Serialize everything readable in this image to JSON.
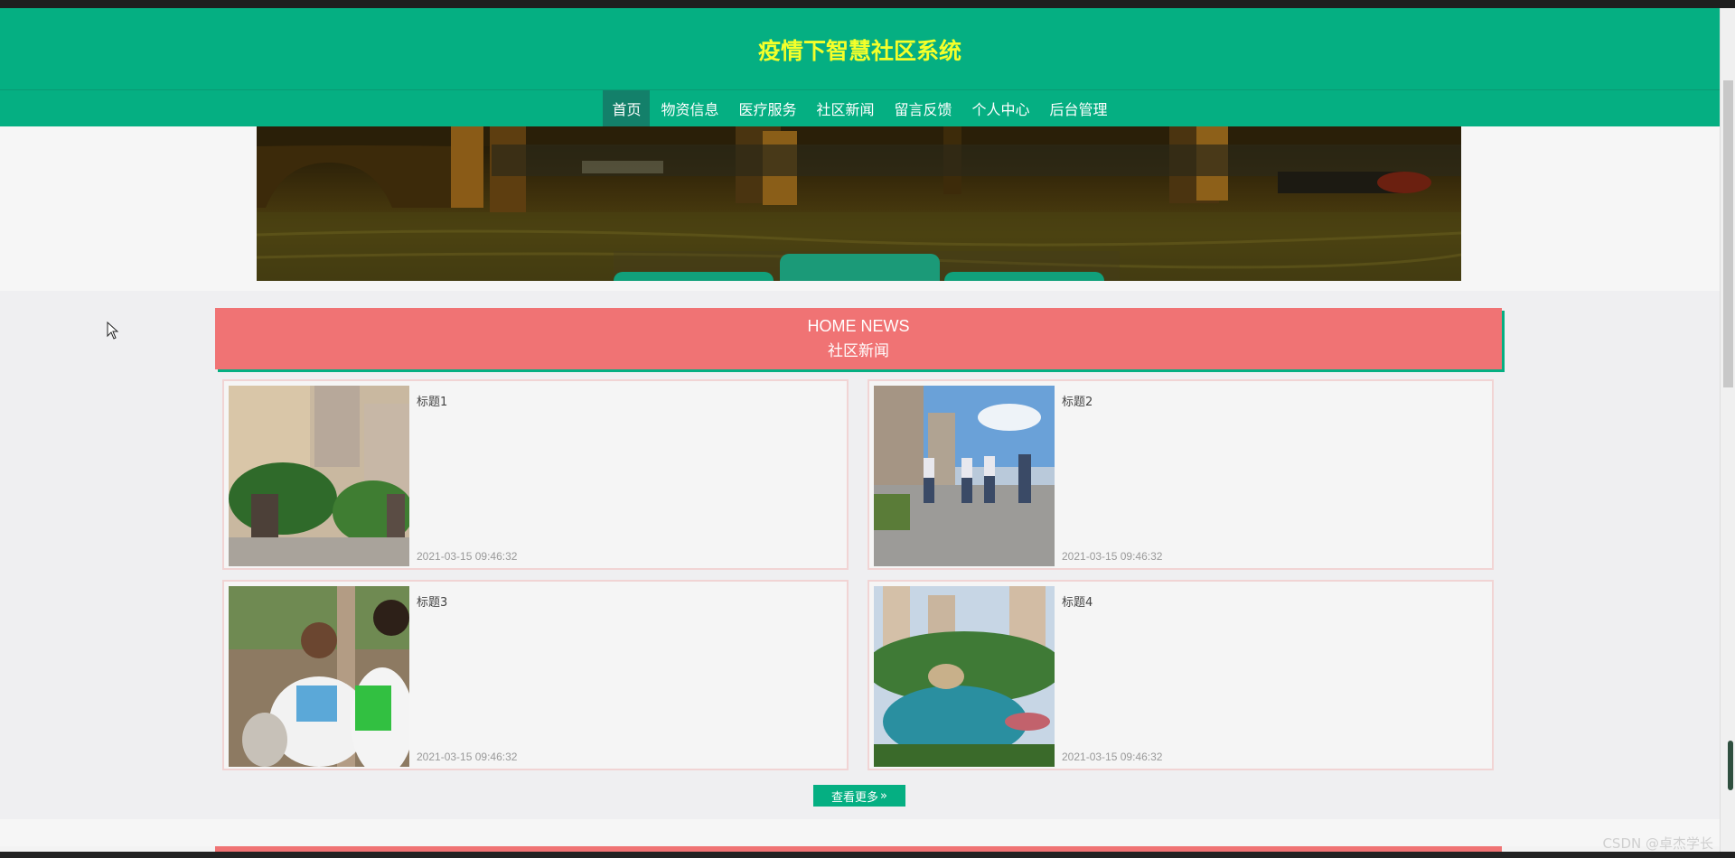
{
  "header": {
    "title": "疫情下智慧社区系统"
  },
  "nav": {
    "items": [
      {
        "label": "首页",
        "active": true
      },
      {
        "label": "物资信息"
      },
      {
        "label": "医疗服务"
      },
      {
        "label": "社区新闻"
      },
      {
        "label": "留言反馈"
      },
      {
        "label": "个人中心"
      },
      {
        "label": "后台管理"
      }
    ]
  },
  "news": {
    "heading_en": "HOME NEWS",
    "heading_cn": "社区新闻",
    "items": [
      {
        "title": "标题1",
        "date": "2021-03-15 09:46:32"
      },
      {
        "title": "标题2",
        "date": "2021-03-15 09:46:32"
      },
      {
        "title": "标题3",
        "date": "2021-03-15 09:46:32"
      },
      {
        "title": "标题4",
        "date": "2021-03-15 09:46:32"
      }
    ],
    "more_label": "查看更多",
    "more_icon": "double-chevron-right-icon"
  },
  "watermark": "CSDN @卓杰学长",
  "colors": {
    "primary": "#05af82",
    "title_yellow": "#f4ff2a",
    "news_header": "#f07374"
  }
}
